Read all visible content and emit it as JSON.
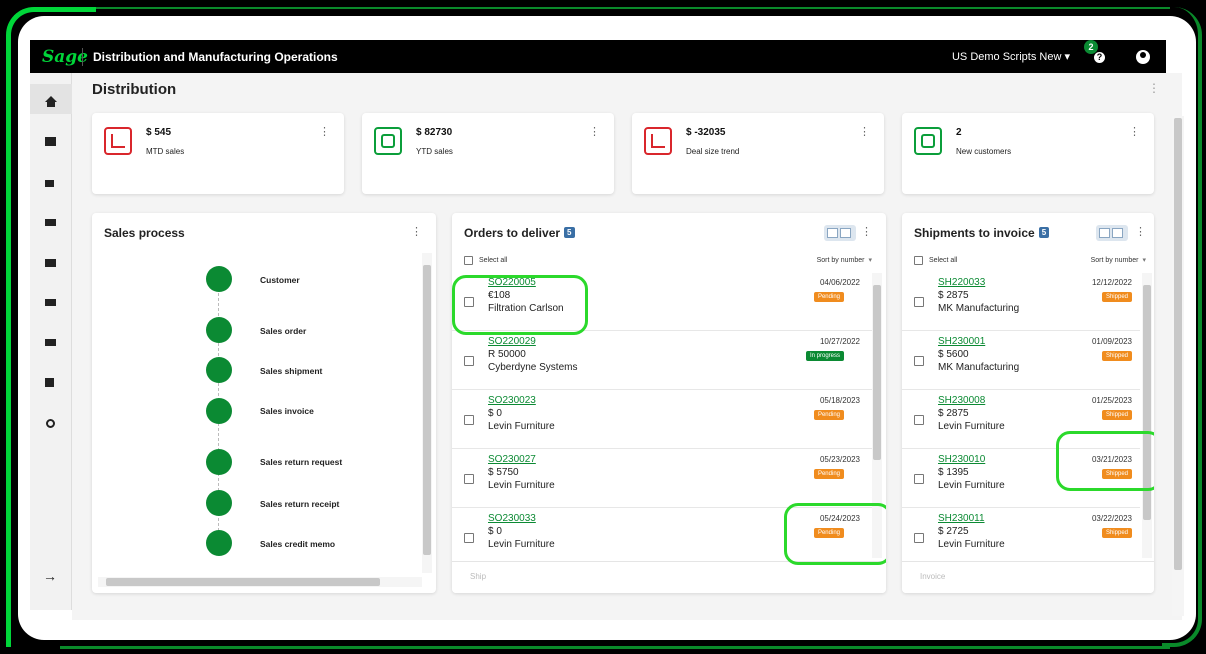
{
  "topbar": {
    "logo": "Sage",
    "app_title": "Distribution and Manufacturing Operations",
    "company": "US Demo Scripts New",
    "company_caret": "▾",
    "notification_count": "2",
    "help": "?"
  },
  "page": {
    "title": "Distribution",
    "kebab": "⋮"
  },
  "kpis": [
    {
      "value": "$ 545",
      "label": "MTD sales",
      "icon": "trend-down-icon"
    },
    {
      "value": "$ 82730",
      "label": "YTD sales",
      "icon": "briefcase-icon"
    },
    {
      "value": "$ -32035",
      "label": "Deal size trend",
      "icon": "trend-down-icon"
    },
    {
      "value": "2",
      "label": "New customers",
      "icon": "customer-icon"
    }
  ],
  "sales_process": {
    "title": "Sales process",
    "steps": [
      "Customer",
      "Sales order",
      "Sales shipment",
      "Sales invoice",
      "Sales return request",
      "Sales return receipt",
      "Sales credit memo"
    ]
  },
  "orders": {
    "title": "Orders to deliver",
    "count": "5",
    "select_all": "Select all",
    "sort": "Sort by number",
    "footer": "Ship",
    "rows": [
      {
        "id": "SO220005",
        "amount": "€108",
        "customer": "Filtration Carlson",
        "date": "04/06/2022",
        "status": "Pending"
      },
      {
        "id": "SO220029",
        "amount": "R 50000",
        "customer": "Cyberdyne Systems",
        "date": "10/27/2022",
        "status": "In progress"
      },
      {
        "id": "SO230023",
        "amount": "$ 0",
        "customer": "Levin Furniture",
        "date": "05/18/2023",
        "status": "Pending"
      },
      {
        "id": "SO230027",
        "amount": "$ 5750",
        "customer": "Levin Furniture",
        "date": "05/23/2023",
        "status": "Pending"
      },
      {
        "id": "SO230033",
        "amount": "$ 0",
        "customer": "Levin Furniture",
        "date": "05/24/2023",
        "status": "Pending"
      }
    ]
  },
  "shipments": {
    "title": "Shipments to invoice",
    "count": "5",
    "select_all": "Select all",
    "sort": "Sort by number",
    "footer": "Invoice",
    "rows": [
      {
        "id": "SH220033",
        "amount": "$ 2875",
        "customer": "MK Manufacturing",
        "date": "12/12/2022",
        "status": "Shipped"
      },
      {
        "id": "SH230001",
        "amount": "$ 5600",
        "customer": "MK Manufacturing",
        "date": "01/09/2023",
        "status": "Shipped"
      },
      {
        "id": "SH230008",
        "amount": "$ 2875",
        "customer": "Levin Furniture",
        "date": "01/25/2023",
        "status": "Shipped"
      },
      {
        "id": "SH230010",
        "amount": "$ 1395",
        "customer": "Levin Furniture",
        "date": "03/21/2023",
        "status": "Shipped"
      },
      {
        "id": "SH230011",
        "amount": "$ 2725",
        "customer": "Levin Furniture",
        "date": "03/22/2023",
        "status": "Shipped"
      }
    ]
  },
  "colors": {
    "brand": "#00d639",
    "accent": "#0b8a33",
    "pending": "#f08c1e",
    "highlight": "#2bd92b"
  }
}
